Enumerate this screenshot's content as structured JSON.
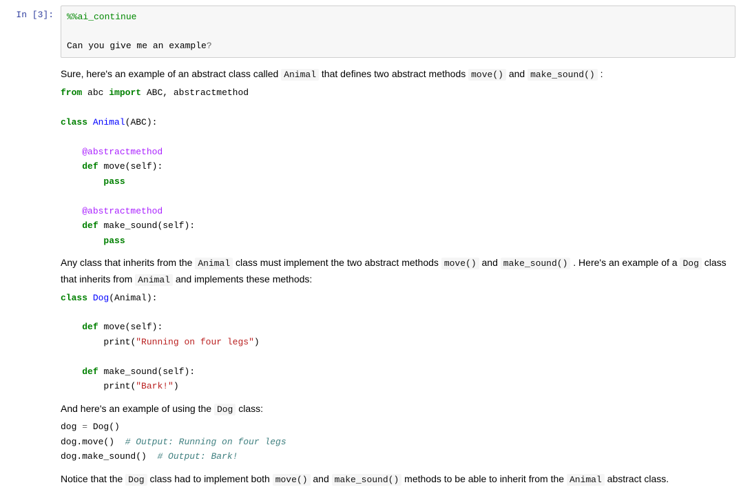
{
  "cell": {
    "prompt_label": "In [3]:",
    "magic_line": "%%ai_continue",
    "blank": "",
    "user_line_pre": "Can you give me an example",
    "user_line_q": "?"
  },
  "out": {
    "p1_a": "Sure, here's an example of an abstract class called ",
    "p1_code1": "Animal",
    "p1_b": " that defines two abstract methods ",
    "p1_code2": "move()",
    "p1_c": " and ",
    "p1_code3": "make_sound()",
    "p1_d": " :",
    "code1": {
      "l1_kw1": "from",
      "l1_sp1": " abc ",
      "l1_kw2": "import",
      "l1_sp2": " ABC, abstractmethod",
      "blank": "",
      "l2_kw": "class",
      "l2_sp": " ",
      "l2_cls": "Animal",
      "l2_rest": "(ABC):",
      "l3_ind": "    ",
      "l3_dec": "@abstractmethod",
      "l4_ind": "    ",
      "l4_kw": "def",
      "l4_sp": " ",
      "l4_name": "move",
      "l4_rest": "(self):",
      "l5_ind": "        ",
      "l5_kw": "pass",
      "l6_dec": "@abstractmethod",
      "l7_name": "make_sound"
    },
    "p2_a": "Any class that inherits from the ",
    "p2_code1": "Animal",
    "p2_b": " class must implement the two abstract methods ",
    "p2_code2": "move()",
    "p2_c": " and ",
    "p2_code3": "make_sound()",
    "p2_d": " . Here's an example of a ",
    "p2_code4": "Dog",
    "p2_e": " class that inherits from ",
    "p2_code5": "Animal",
    "p2_f": " and implements these methods:",
    "code2": {
      "l1_kw": "class",
      "l1_cls": "Dog",
      "l1_rest": "(Animal):",
      "l2_kw": "def",
      "l2_name": "move",
      "l2_rest": "(self):",
      "l3_print": "print",
      "l3_str": "\"Running on four legs\"",
      "l4_name": "make_sound",
      "l5_str": "\"Bark!\""
    },
    "p3_a": "And here's an example of using the ",
    "p3_code1": "Dog",
    "p3_b": " class:",
    "code3": {
      "l1": "dog ",
      "l1_op": "=",
      "l1_b": " Dog()",
      "l2": "dog.move()  ",
      "l2_com": "# Output: Running on four legs",
      "l3": "dog.make_sound()  ",
      "l3_com": "# Output: Bark!"
    },
    "p4_a": "Notice that the ",
    "p4_code1": "Dog",
    "p4_b": " class had to implement both ",
    "p4_code2": "move()",
    "p4_c": " and ",
    "p4_code3": "make_sound()",
    "p4_d": " methods to be able to inherit from the ",
    "p4_code4": "Animal",
    "p4_e": " abstract class."
  }
}
